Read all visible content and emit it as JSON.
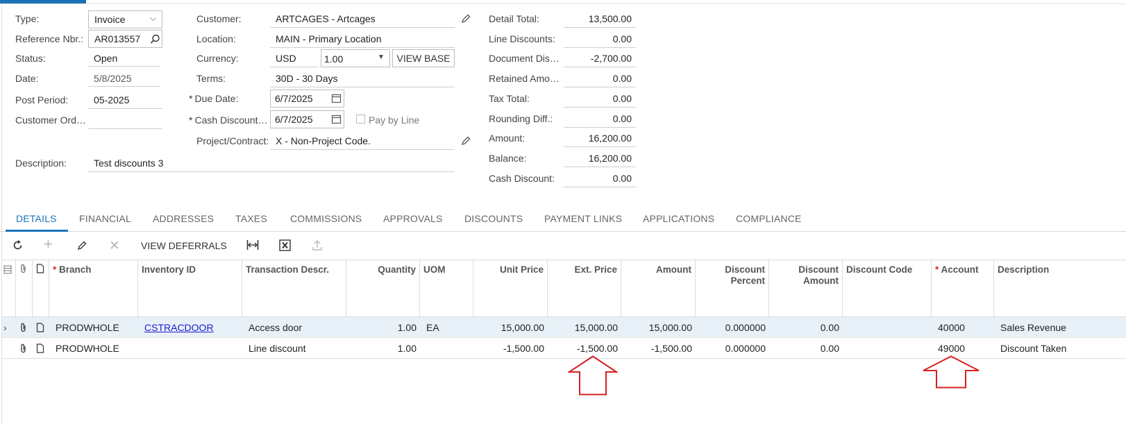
{
  "form": {
    "type": {
      "label": "Type:",
      "value": "Invoice"
    },
    "reference": {
      "label": "Reference Nbr.:",
      "value": "AR013557"
    },
    "status": {
      "label": "Status:",
      "value": "Open"
    },
    "date": {
      "label": "Date:",
      "value": "5/8/2025"
    },
    "post_period": {
      "label": "Post Period:",
      "value": "05-2025"
    },
    "customer_order": {
      "label": "Customer Ord…",
      "value": ""
    },
    "description": {
      "label": "Description:",
      "value": "Test discounts 3"
    },
    "customer": {
      "label": "Customer:",
      "value": "ARTCAGES - Artcages"
    },
    "location": {
      "label": "Location:",
      "value": "MAIN - Primary Location"
    },
    "currency": {
      "label": "Currency:",
      "value": "USD",
      "rate": "1.00",
      "view_base": "VIEW BASE"
    },
    "terms": {
      "label": "Terms:",
      "value": "30D - 30 Days"
    },
    "due_date": {
      "label": "Due Date:",
      "value": "6/7/2025"
    },
    "cash_discount_date": {
      "label": "Cash Discount…",
      "value": "6/7/2025"
    },
    "pay_by_line": {
      "label": "Pay by Line",
      "checked": false
    },
    "project": {
      "label": "Project/Contract:",
      "value": "X - Non-Project Code."
    }
  },
  "totals": [
    {
      "label": "Detail Total:",
      "value": "13,500.00"
    },
    {
      "label": "Line Discounts:",
      "value": "0.00"
    },
    {
      "label": "Document Dis…",
      "value": "-2,700.00"
    },
    {
      "label": "Retained Amo…",
      "value": "0.00"
    },
    {
      "label": "Tax Total:",
      "value": "0.00"
    },
    {
      "label": "Rounding Diff.:",
      "value": "0.00"
    },
    {
      "label": "Amount:",
      "value": "16,200.00"
    },
    {
      "label": "Balance:",
      "value": "16,200.00"
    },
    {
      "label": "Cash Discount:",
      "value": "0.00"
    }
  ],
  "tabs": [
    "DETAILS",
    "FINANCIAL",
    "ADDRESSES",
    "TAXES",
    "COMMISSIONS",
    "APPROVALS",
    "DISCOUNTS",
    "PAYMENT LINKS",
    "APPLICATIONS",
    "COMPLIANCE"
  ],
  "toolbar": {
    "view_deferrals": "VIEW DEFERRALS"
  },
  "grid": {
    "headers": {
      "branch": "Branch",
      "inventory": "Inventory ID",
      "trans_descr": "Transaction Descr.",
      "quantity": "Quantity",
      "uom": "UOM",
      "unit_price": "Unit Price",
      "ext_price": "Ext. Price",
      "amount": "Amount",
      "disc_percent_1": "Discount",
      "disc_percent_2": "Percent",
      "disc_amount_1": "Discount",
      "disc_amount_2": "Amount",
      "disc_code": "Discount Code",
      "account": "Account",
      "description": "Description"
    },
    "rows": [
      {
        "branch": "PRODWHOLE",
        "inventory": "CSTRACDOOR",
        "trans_descr": "Access door",
        "quantity": "1.00",
        "uom": "EA",
        "unit_price": "15,000.00",
        "ext_price": "15,000.00",
        "amount": "15,000.00",
        "disc_percent": "0.000000",
        "disc_amount": "0.00",
        "disc_code": "",
        "account": "40000",
        "description": "Sales Revenue"
      },
      {
        "branch": "PRODWHOLE",
        "inventory": "",
        "trans_descr": "Line discount",
        "quantity": "1.00",
        "uom": "",
        "unit_price": "-1,500.00",
        "ext_price": "-1,500.00",
        "amount": "-1,500.00",
        "disc_percent": "0.000000",
        "disc_amount": "0.00",
        "disc_code": "",
        "account": "49000",
        "description": "Discount Taken"
      }
    ]
  },
  "colors": {
    "accent": "#1a73b8",
    "selected_row": "#e8f1f8",
    "annotation_arrow": "#d42020",
    "link": "#1a1ad0"
  }
}
